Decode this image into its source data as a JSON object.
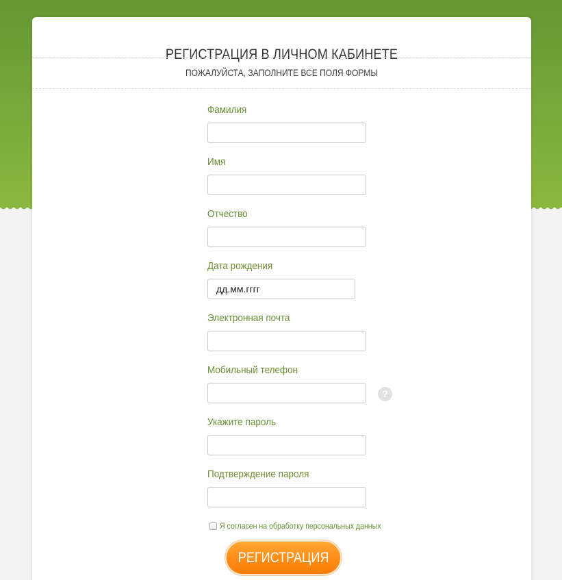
{
  "page": {
    "title": "РЕГИСТРАЦИЯ В ЛИЧНОМ КАБИНЕТЕ",
    "subtitle": "ПОЖАЛУЙСТА, ЗАПОЛНИТЕ ВСЕ ПОЛЯ ФОРМЫ"
  },
  "form": {
    "last_name": {
      "label": "Фамилия",
      "value": ""
    },
    "first_name": {
      "label": "Имя",
      "value": ""
    },
    "patronymic": {
      "label": "Отчество",
      "value": ""
    },
    "birth_date": {
      "label": "Дата рождения",
      "placeholder": "дд.мм.гггг",
      "value": ""
    },
    "email": {
      "label": "Электронная почта",
      "value": ""
    },
    "phone": {
      "label": "Мобильный телефон",
      "value": "",
      "help_icon": "question-icon",
      "help_glyph": "?"
    },
    "password": {
      "label": "Укажите пароль",
      "value": ""
    },
    "password_confirm": {
      "label": "Подтверждение пароля",
      "value": ""
    },
    "consent": {
      "label": "Я согласен на обработку персональных данных",
      "checked": false
    },
    "submit_label": "РЕГИСТРАЦИЯ"
  },
  "colors": {
    "header_green": "#76a63a",
    "label_green": "#6a8e35",
    "button_orange": "#ff8d17",
    "page_background": "#f2f2f2"
  }
}
